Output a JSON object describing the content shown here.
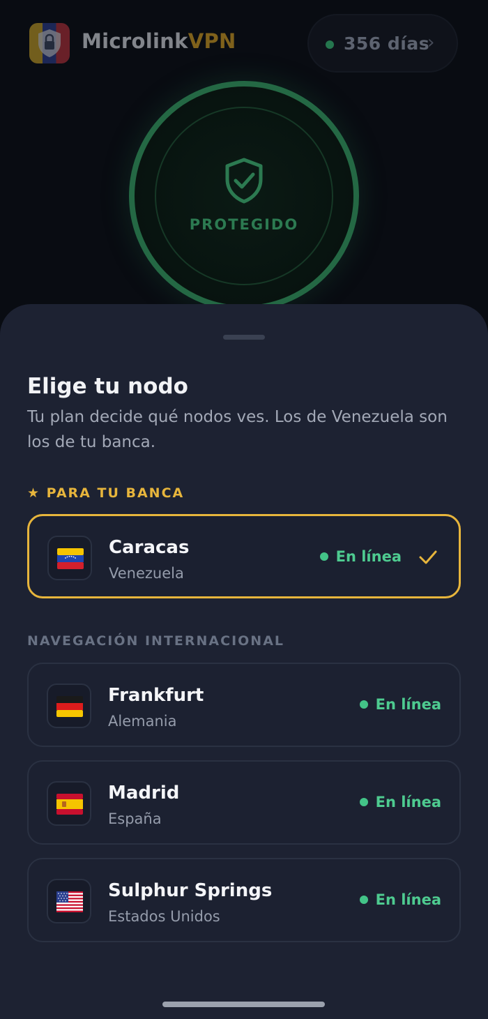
{
  "header": {
    "brand_part1": "Microlink",
    "brand_part2": "VPN",
    "days_badge": "356 días",
    "days_chevron": "›"
  },
  "connection": {
    "status_label": "PROTEGIDO"
  },
  "sheet": {
    "title": "Elige tu nodo",
    "subtitle": "Tu plan decide qué nodos ves. Los de Venezuela son los de tu banca.",
    "bank_section": {
      "label": "★ PARA TU BANCA",
      "node": {
        "city": "Caracas",
        "country": "Venezuela",
        "status": "En línea",
        "flag": "venezuela-flag",
        "selected": true
      }
    },
    "intl_section": {
      "label": "NAVEGACIÓN INTERNACIONAL",
      "nodes": [
        {
          "city": "Frankfurt",
          "country": "Alemania",
          "status": "En línea",
          "flag": "germany-flag"
        },
        {
          "city": "Madrid",
          "country": "España",
          "status": "En línea",
          "flag": "spain-flag"
        },
        {
          "city": "Sulphur Springs",
          "country": "Estados Unidos",
          "status": "En línea",
          "flag": "usa-flag"
        }
      ]
    }
  },
  "colors": {
    "accent_gold": "#e7b53c",
    "online_green": "#4ecb90",
    "sheet_bg": "#1d2232"
  }
}
